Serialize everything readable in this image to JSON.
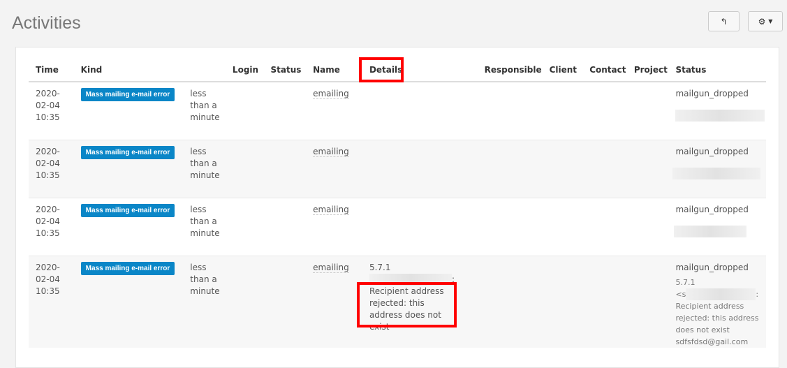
{
  "title": "Activities",
  "buttons": {
    "back_icon": "back-arrow-icon",
    "settings_icon": "gear-icon"
  },
  "columns": [
    "Time",
    "Kind",
    "",
    "Login",
    "Status",
    "Name",
    "Details",
    "Responsible",
    "Client",
    "Contact",
    "Project",
    "Status"
  ],
  "rows": [
    {
      "time": "2020-02-04 10:35",
      "kind": "Mass mailing e-mail error",
      "ago": "less than a minute",
      "name": "emailing",
      "details": "",
      "status": "mailgun_dropped",
      "status_detail": ""
    },
    {
      "time": "2020-02-04 10:35",
      "kind": "Mass mailing e-mail error",
      "ago": "less than a minute",
      "name": "emailing",
      "details": "",
      "status": "mailgun_dropped",
      "status_detail": ""
    },
    {
      "time": "2020-02-04 10:35",
      "kind": "Mass mailing e-mail error",
      "ago": "less than a minute",
      "name": "emailing",
      "details": "",
      "status": "mailgun_dropped",
      "status_detail": ""
    },
    {
      "time": "2020-02-04 10:35",
      "kind": "Mass mailing e-mail error",
      "ago": "less than a minute",
      "name": "emailing",
      "details_code": "5.7.1",
      "details": "Recipient address rejected: this address does not exist",
      "status": "mailgun_dropped",
      "status_code": "5.7.1",
      "status_prefix": "<s",
      "status_detail": "Recipient address rejected: this address does not exist",
      "status_email": "sdfsfdsd@gail.com"
    }
  ]
}
